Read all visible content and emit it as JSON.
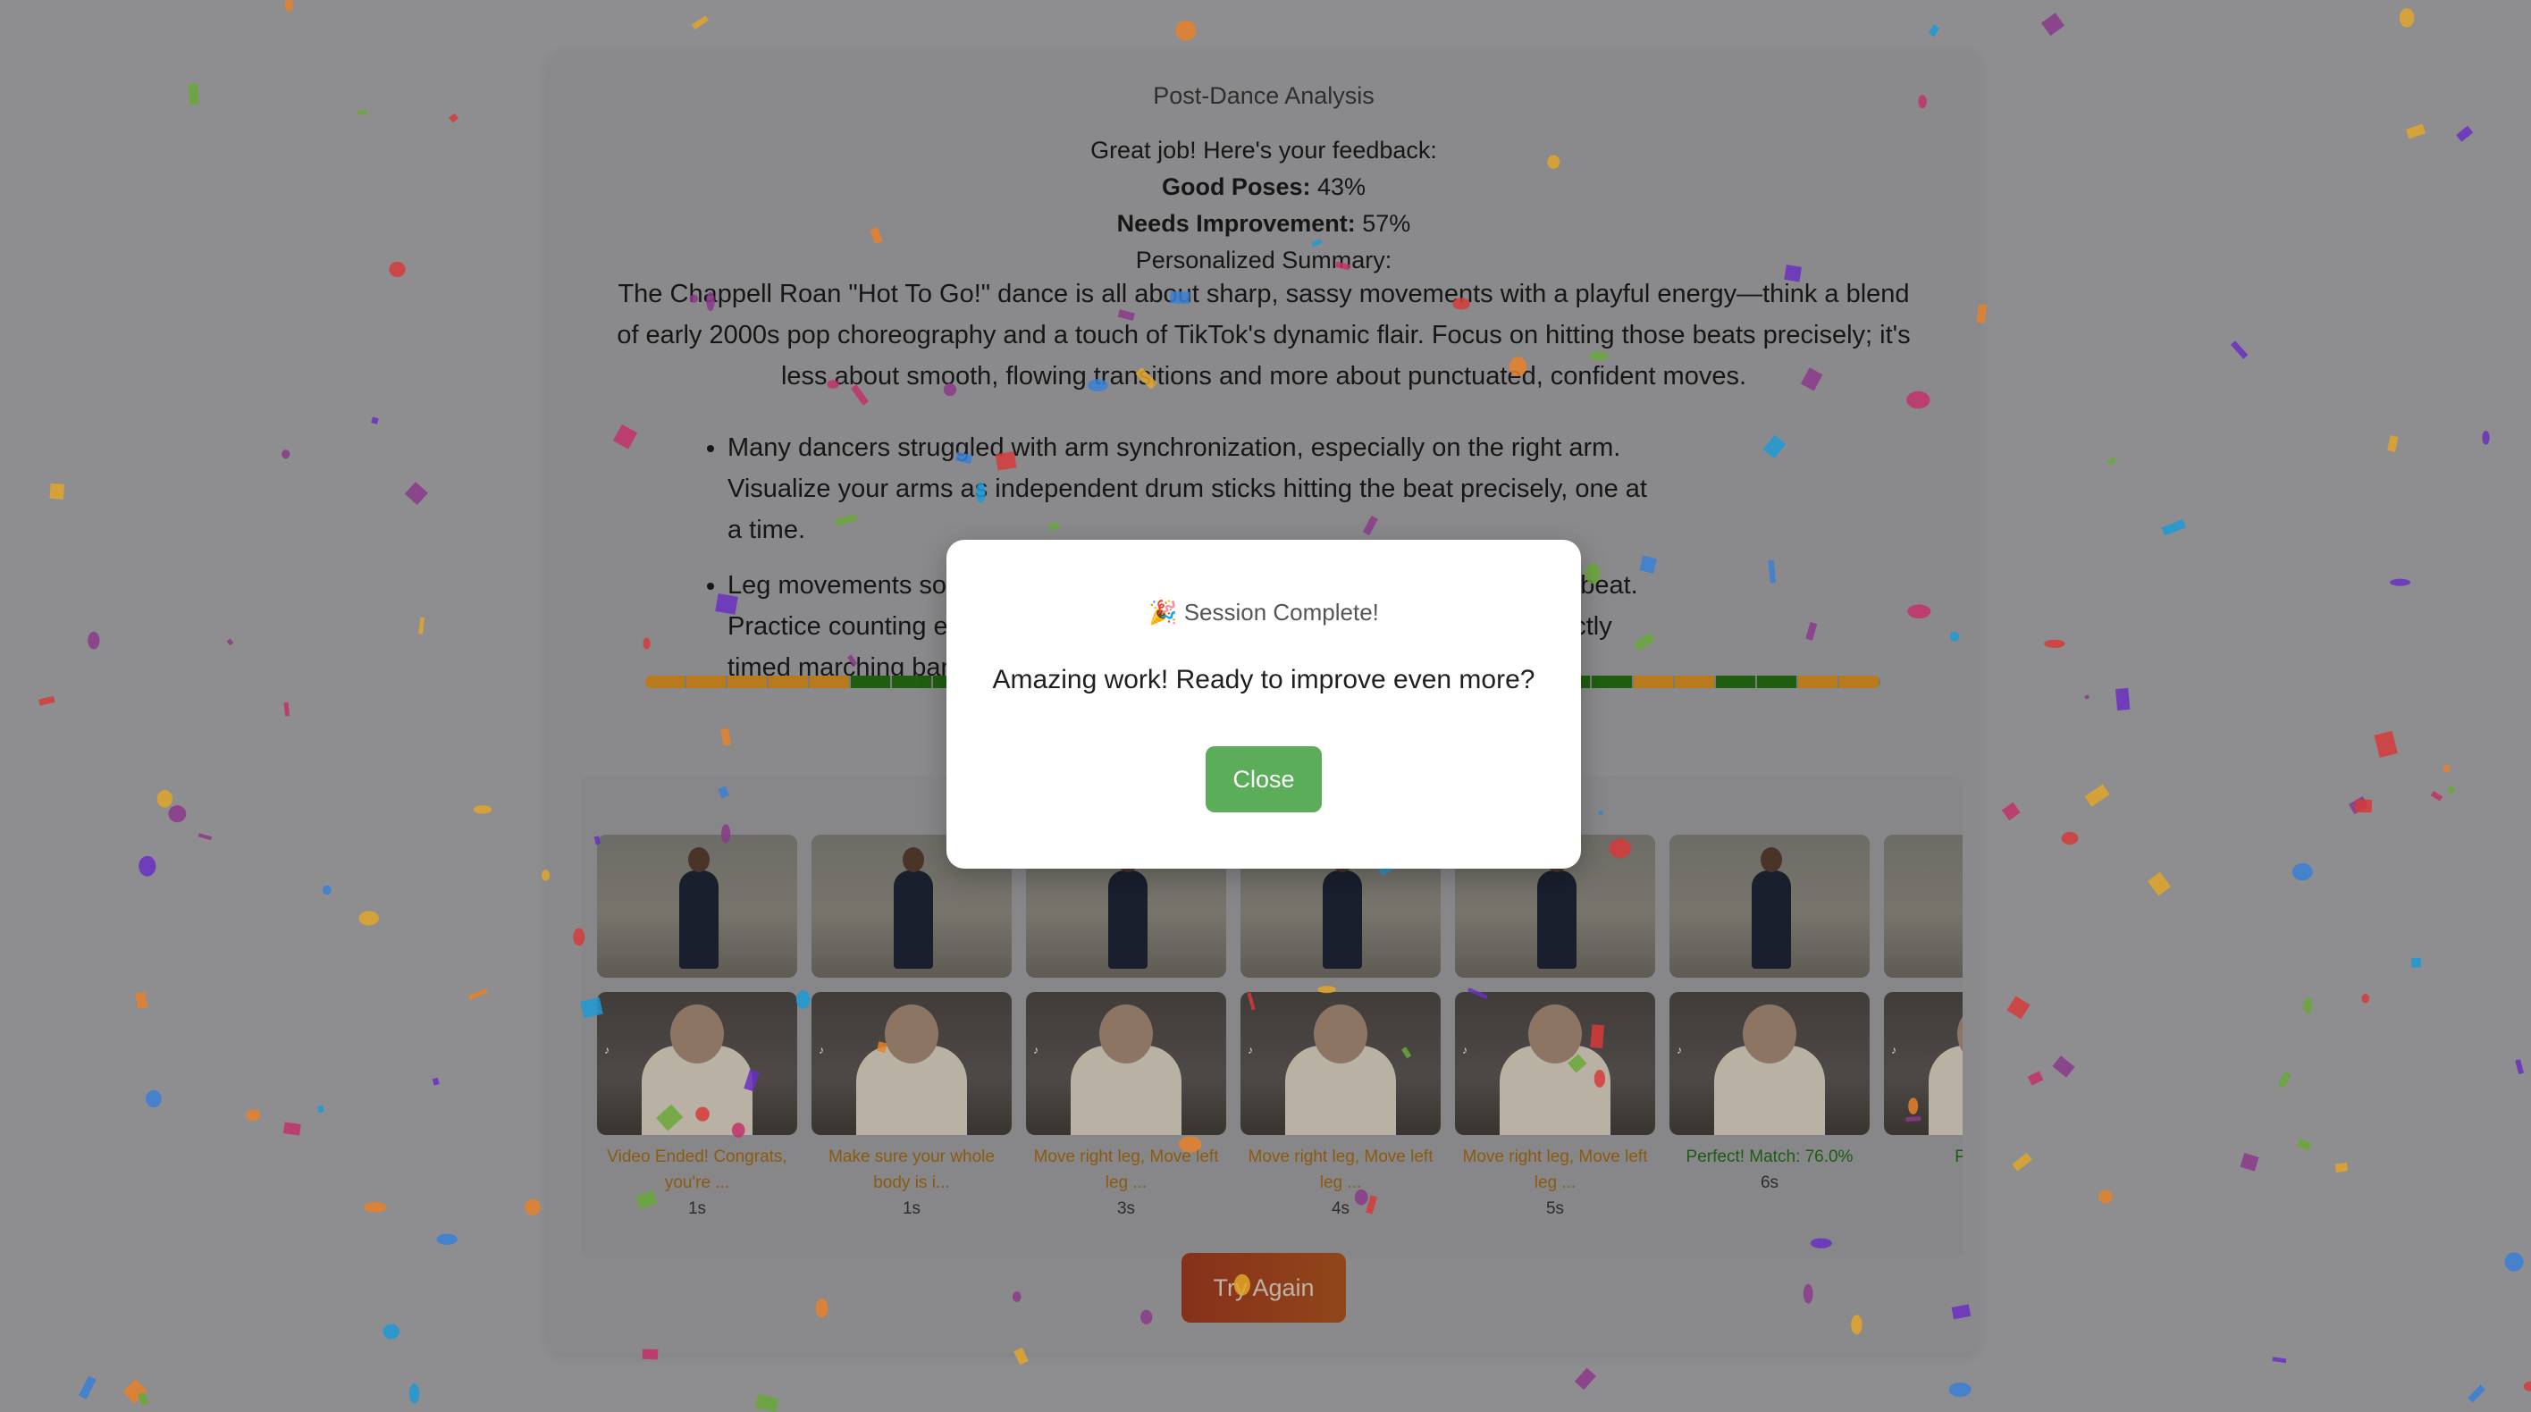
{
  "page": {
    "title": "Post-Dance Analysis",
    "feedback_intro": "Great job! Here's your feedback:",
    "good_poses_label": "Good Poses:",
    "good_poses_value": "43%",
    "needs_improvement_label": "Needs Improvement:",
    "needs_improvement_value": "57%",
    "summary_label": "Personalized Summary:",
    "summary_text": "The Chappell Roan \"Hot To Go!\" dance is all about sharp, sassy movements with a playful energy—think a blend of early 2000s pop choreography and a touch of TikTok's dynamic flair. Focus on hitting those beats precisely; it's less about smooth, flowing transitions and more about punctuated, confident moves.",
    "tips": [
      "Many dancers struggled with arm synchronization, especially on the right arm. Visualize your arms as independent drum sticks hitting the beat precisely, one at a time.",
      "Leg movements sometimes lacked precision, occurring slightly behind the beat. Practice counting each leg movement aloud, as if you were part of a perfectly timed marching band."
    ],
    "try_again_label": "Try Again"
  },
  "timeline": {
    "colors": {
      "good": "#1f5e10",
      "bad": "#b87a1c"
    },
    "segments": [
      "bad",
      "bad",
      "bad",
      "bad",
      "bad",
      "good",
      "good",
      "good",
      "good",
      "bad",
      "bad",
      "bad",
      "bad",
      "bad",
      "bad",
      "bad",
      "bad",
      "bad",
      "bad",
      "bad",
      "bad",
      "bad",
      "good",
      "good",
      "bad",
      "bad",
      "good",
      "good",
      "bad",
      "bad"
    ]
  },
  "frames": [
    {
      "label": "Video Ended! Congrats, you're ...",
      "time": "1s",
      "status": "bad"
    },
    {
      "label": "Make sure your whole body is i...",
      "time": "1s",
      "status": "bad"
    },
    {
      "label": "Move right leg, Move left leg ...",
      "time": "3s",
      "status": "bad"
    },
    {
      "label": "Move right leg, Move left leg ...",
      "time": "4s",
      "status": "bad"
    },
    {
      "label": "Move right leg, Move left leg ...",
      "time": "5s",
      "status": "bad"
    },
    {
      "label": "Perfect! Match: 76.0%",
      "time": "6s",
      "status": "good"
    },
    {
      "label": "Perfect!",
      "time": "",
      "status": "good"
    }
  ],
  "modal": {
    "icon": "party-popper-icon",
    "emoji": "🎉",
    "title": "Session Complete!",
    "message": "Amazing work! Ready to improve even more?",
    "close_label": "Close"
  },
  "colors": {
    "close_button": "#5cad5a",
    "try_again_button": "#d4552a"
  }
}
